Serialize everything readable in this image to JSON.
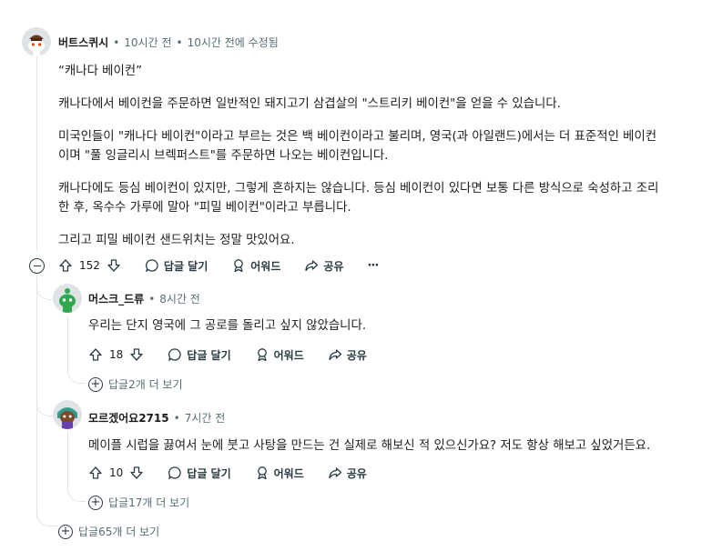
{
  "comment": {
    "username": "버트스퀴시",
    "time": "10시간 전",
    "edited": "10시간 전에 수정됨",
    "paragraphs": [
      "“캐나다 베이컨”",
      "캐나다에서 베이컨을 주문하면 일반적인 돼지고기 삼겹살의 \"스트리키 베이컨\"을 얻을 수 있습니다.",
      "미국인들이 \"캐나다 베이컨\"이라고 부르는 것은 백 베이컨이라고 불리며, 영국(과 아일랜드)에서는 더 표준적인 베이컨\n이며 \"풀 잉글리시 브렉퍼스트\"를 주문하면 나오는 베이컨입니다.",
      "캐나다에도 등심 베이컨이 있지만, 그렇게 흔하지는 않습니다. 등심 베이컨이 있다면 보통 다른 방식으로 숙성하고 조리\n한 후, 옥수수 가루에 말아 \"피밀 베이컨\"이라고 부릅니다.",
      "그리고 피밀 베이컨 샌드위치는 정말 맛있어요."
    ],
    "votes": "152",
    "reply_label": "답글 달기",
    "award_label": "어워드",
    "share_label": "공유",
    "more_label": "···",
    "more_replies": "답글65개 더 보기"
  },
  "replies": [
    {
      "username": "머스크_드류",
      "time": "8시간 전",
      "text": "우리는 단지 영국에 그 공로를 돌리고 싶지 않았습니다.",
      "votes": "18",
      "reply_label": "답글 달기",
      "award_label": "어워드",
      "share_label": "공유",
      "more_replies": "답글2개 더 보기"
    },
    {
      "username": "모르겠어요2715",
      "time": "7시간 전",
      "text": "메이플 시럽을 끓여서 눈에 붓고 사탕을 만드는 건 실제로 해보신 적 있으신가요? 저도 항상 해보고 싶었거든요.",
      "votes": "10",
      "reply_label": "답글 달기",
      "award_label": "어워드",
      "share_label": "공유",
      "more_replies": "답글17개 더 보기"
    }
  ]
}
